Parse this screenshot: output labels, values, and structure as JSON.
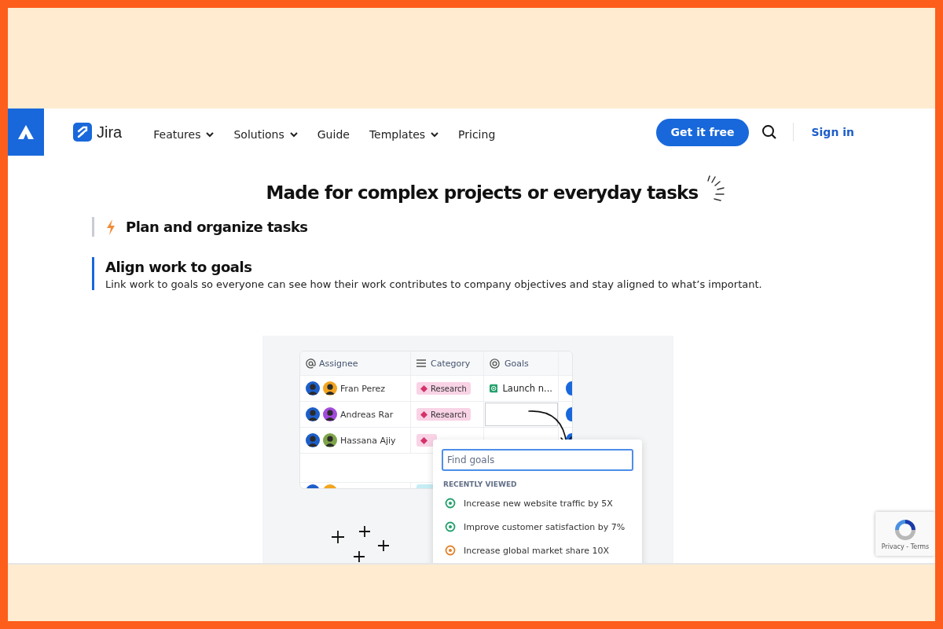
{
  "nav": {
    "brand": "Jira",
    "items": [
      {
        "label": "Features",
        "dropdown": true
      },
      {
        "label": "Solutions",
        "dropdown": true
      },
      {
        "label": "Guide",
        "dropdown": false
      },
      {
        "label": "Templates",
        "dropdown": true
      },
      {
        "label": "Pricing",
        "dropdown": false
      }
    ],
    "cta": "Get it free",
    "sign_in": "Sign in"
  },
  "heading": "Made for complex projects or everyday tasks",
  "features": [
    {
      "title": "Plan and organize tasks",
      "selected": false
    },
    {
      "title": "Align work to goals",
      "selected": true,
      "description": "Link work to goals so everyone can see how their work contributes to company objectives and stay aligned to what’s important."
    }
  ],
  "table": {
    "columns": [
      "Assignee",
      "Category",
      "Goals"
    ],
    "rows": [
      {
        "name": "Fran Perez",
        "category": "Research",
        "goal": "Launch n..."
      },
      {
        "name": "Andreas Rar",
        "category": "Research"
      },
      {
        "name": "Hassana Ajiy"
      }
    ]
  },
  "popup": {
    "placeholder": "Find goals",
    "section": "RECENTLY VIEWED",
    "goals": [
      {
        "label": "Increase new website traffic by 5X",
        "color": "#22a06b"
      },
      {
        "label": "Improve customer satisfaction by 7%",
        "color": "#22a06b"
      },
      {
        "label": "Increase global market share 10X",
        "color": "#e2822b"
      }
    ]
  },
  "recaptcha": "Privacy - Terms"
}
